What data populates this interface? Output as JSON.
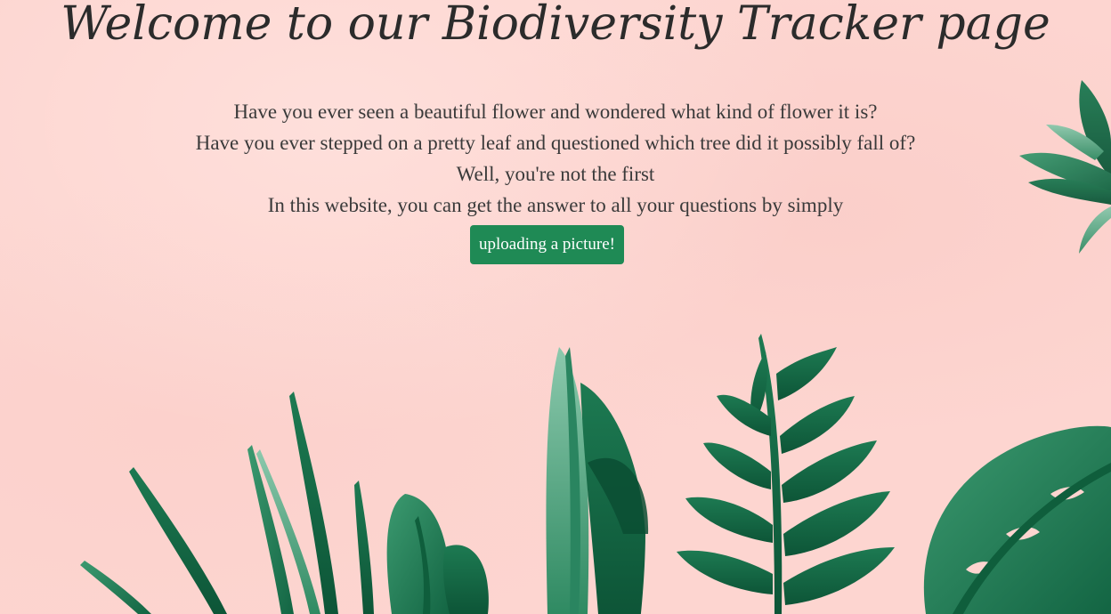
{
  "page": {
    "title": "Welcome to our Biodiversity Tracker page",
    "intro_lines": [
      "Have you ever seen a beautiful flower and wondered what kind of  flower it is?",
      "Have you ever stepped on a pretty leaf  and questioned which tree did it possibly fall of?",
      "Well, you're not the first",
      "In this website, you can get the answer to all your questions by simply"
    ],
    "upload_button_label": "uploading a picture!"
  },
  "colors": {
    "background": "#fdd5d0",
    "button": "#1f8a55",
    "leaf_dark": "#0f5e3c",
    "leaf_mid": "#1d7a52",
    "leaf_light": "#5fae8b"
  }
}
